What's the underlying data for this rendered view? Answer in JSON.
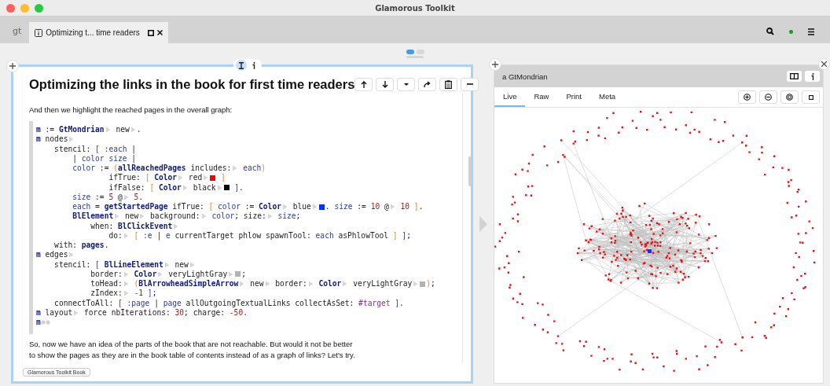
{
  "window": {
    "title": "Glamorous Toolkit"
  },
  "tabbar": {
    "logo": "gt",
    "tabs": [
      {
        "label": "Optimizing t... time readers",
        "selected": true
      }
    ]
  },
  "page": {
    "modes": [
      {
        "kind": "edit",
        "selected": true
      },
      {
        "kind": "info",
        "selected": false
      }
    ],
    "title": "Optimizing the links in the book for first time readers",
    "intro": "And then we highlight the reached pages in the overall graph:",
    "code": [
      [
        {
          "kind": "var",
          "text": "m"
        },
        {
          "kind": "plain",
          "text": " := "
        },
        {
          "kind": "cls",
          "text": "GtMondrian"
        },
        {
          "kind": "arrow"
        },
        {
          "kind": "plain",
          "text": " new"
        },
        {
          "kind": "arrow"
        },
        {
          "kind": "plain",
          "text": "."
        }
      ],
      [
        {
          "kind": "var",
          "text": "m"
        },
        {
          "kind": "plain",
          "text": " nodes"
        },
        {
          "kind": "arrow"
        }
      ],
      [
        {
          "kind": "plain",
          "text": "    stencil: "
        },
        {
          "kind": "ident",
          "text": "[ :each"
        },
        {
          "kind": "plain",
          "text": " |"
        }
      ],
      [
        {
          "kind": "plain",
          "text": "        | "
        },
        {
          "kind": "ident",
          "text": "color size"
        },
        {
          "kind": "plain",
          "text": " |"
        }
      ],
      [
        {
          "kind": "ident",
          "text": "        color"
        },
        {
          "kind": "plain",
          "text": " := "
        },
        {
          "kind": "brk",
          "text": "("
        },
        {
          "kind": "cls",
          "text": "allReachedPages"
        },
        {
          "kind": "plain",
          "text": " includes:"
        },
        {
          "kind": "arrow"
        },
        {
          "kind": "ident",
          "text": " each"
        },
        {
          "kind": "brk",
          "text": ")"
        }
      ],
      [
        {
          "kind": "plain",
          "text": "                ifTrue: "
        },
        {
          "kind": "brk",
          "text": "[ "
        },
        {
          "kind": "cls",
          "text": "Color"
        },
        {
          "kind": "arrow"
        },
        {
          "kind": "plain",
          "text": " red"
        },
        {
          "kind": "arrow"
        },
        {
          "kind": "swatch",
          "color": "#ff0000"
        },
        {
          "kind": "brk",
          "text": " ]"
        }
      ],
      [
        {
          "kind": "plain",
          "text": "                ifFalse: "
        },
        {
          "kind": "brk",
          "text": "[ "
        },
        {
          "kind": "cls",
          "text": "Color"
        },
        {
          "kind": "arrow"
        },
        {
          "kind": "plain",
          "text": " black"
        },
        {
          "kind": "arrow"
        },
        {
          "kind": "swatch",
          "color": "#000000"
        },
        {
          "kind": "ident",
          "text": " ]"
        },
        {
          "kind": "plain",
          "text": "."
        }
      ],
      [
        {
          "kind": "ident",
          "text": "        size"
        },
        {
          "kind": "plain",
          "text": " := "
        },
        {
          "kind": "num",
          "text": "5"
        },
        {
          "kind": "plain",
          "text": " @"
        },
        {
          "kind": "arrow"
        },
        {
          "kind": "num",
          "text": " 5"
        },
        {
          "kind": "plain",
          "text": "."
        }
      ],
      [
        {
          "kind": "ident",
          "text": "        each"
        },
        {
          "kind": "plain",
          "text": " = "
        },
        {
          "kind": "cls",
          "text": "getStartedPage"
        },
        {
          "kind": "plain",
          "text": " ifTrue: "
        },
        {
          "kind": "brk",
          "text": "[ "
        },
        {
          "kind": "ident",
          "text": "color"
        },
        {
          "kind": "plain",
          "text": " := "
        },
        {
          "kind": "cls",
          "text": "Color"
        },
        {
          "kind": "arrow"
        },
        {
          "kind": "plain",
          "text": " blue"
        },
        {
          "kind": "arrow"
        },
        {
          "kind": "swatch",
          "color": "#0033ff"
        },
        {
          "kind": "plain",
          "text": ". "
        },
        {
          "kind": "ident",
          "text": "size"
        },
        {
          "kind": "plain",
          "text": " := "
        },
        {
          "kind": "num",
          "text": "10"
        },
        {
          "kind": "plain",
          "text": " @"
        },
        {
          "kind": "arrow"
        },
        {
          "kind": "num",
          "text": " 10"
        },
        {
          "kind": "brk",
          "text": " ]"
        },
        {
          "kind": "plain",
          "text": "."
        }
      ],
      [
        {
          "kind": "cls",
          "text": "        BlElement"
        },
        {
          "kind": "arrow"
        },
        {
          "kind": "plain",
          "text": " new"
        },
        {
          "kind": "arrow"
        },
        {
          "kind": "plain",
          "text": " background:"
        },
        {
          "kind": "arrow"
        },
        {
          "kind": "ident",
          "text": " color"
        },
        {
          "kind": "plain",
          "text": "; size:"
        },
        {
          "kind": "arrow"
        },
        {
          "kind": "ident",
          "text": " size"
        },
        {
          "kind": "plain",
          "text": ";"
        }
      ],
      [
        {
          "kind": "plain",
          "text": "            when: "
        },
        {
          "kind": "cls",
          "text": "BlClickEvent"
        },
        {
          "kind": "arrow"
        }
      ],
      [
        {
          "kind": "plain",
          "text": "                do:"
        },
        {
          "kind": "arrow"
        },
        {
          "kind": "brk",
          "text": " [ "
        },
        {
          "kind": "ident",
          "text": ":e"
        },
        {
          "kind": "plain",
          "text": " | "
        },
        {
          "kind": "ident",
          "text": "e"
        },
        {
          "kind": "plain",
          "text": " currentTarget phlow spawnTool: "
        },
        {
          "kind": "ident",
          "text": "each"
        },
        {
          "kind": "plain",
          "text": " asPhlowTool "
        },
        {
          "kind": "brk",
          "text": "]"
        },
        {
          "kind": "ident",
          "text": " ]"
        },
        {
          "kind": "plain",
          "text": ";"
        }
      ],
      [
        {
          "kind": "plain",
          "text": "    with: "
        },
        {
          "kind": "cls",
          "text": "pages"
        },
        {
          "kind": "plain",
          "text": "."
        }
      ],
      [
        {
          "kind": "var",
          "text": "m"
        },
        {
          "kind": "plain",
          "text": " edges"
        },
        {
          "kind": "arrow"
        }
      ],
      [
        {
          "kind": "plain",
          "text": "    stencil: "
        },
        {
          "kind": "ident",
          "text": "[ "
        },
        {
          "kind": "cls",
          "text": "BlLineElement"
        },
        {
          "kind": "arrow"
        },
        {
          "kind": "plain",
          "text": " new"
        },
        {
          "kind": "arrow"
        }
      ],
      [
        {
          "kind": "plain",
          "text": "            border:"
        },
        {
          "kind": "arrow"
        },
        {
          "kind": "cls",
          "text": " Color"
        },
        {
          "kind": "arrow"
        },
        {
          "kind": "plain",
          "text": " veryLightGray"
        },
        {
          "kind": "arrow"
        },
        {
          "kind": "swatch",
          "color": "#b3b3b3"
        },
        {
          "kind": "plain",
          "text": ";"
        }
      ],
      [
        {
          "kind": "plain",
          "text": "            toHead:"
        },
        {
          "kind": "arrow"
        },
        {
          "kind": "brk",
          "text": " ("
        },
        {
          "kind": "cls",
          "text": "BlArrowheadSimpleArrow"
        },
        {
          "kind": "arrow"
        },
        {
          "kind": "plain",
          "text": " new"
        },
        {
          "kind": "arrow"
        },
        {
          "kind": "plain",
          "text": " border:"
        },
        {
          "kind": "arrow"
        },
        {
          "kind": "cls",
          "text": " Color"
        },
        {
          "kind": "arrow"
        },
        {
          "kind": "plain",
          "text": " veryLightGray"
        },
        {
          "kind": "arrow"
        },
        {
          "kind": "swatch",
          "color": "#b3b3b3"
        },
        {
          "kind": "brk",
          "text": ")"
        },
        {
          "kind": "plain",
          "text": ";"
        }
      ],
      [
        {
          "kind": "plain",
          "text": "            zIndex:"
        },
        {
          "kind": "arrow"
        },
        {
          "kind": "num",
          "text": " -1"
        },
        {
          "kind": "ident",
          "text": " ]"
        },
        {
          "kind": "plain",
          "text": ";"
        }
      ],
      [
        {
          "kind": "plain",
          "text": "    connectToAll: "
        },
        {
          "kind": "ident",
          "text": "[ :page"
        },
        {
          "kind": "plain",
          "text": " | "
        },
        {
          "kind": "ident",
          "text": "page"
        },
        {
          "kind": "plain",
          "text": " allOutgoingTextualLinks collectAsSet: "
        },
        {
          "kind": "sym",
          "text": "#target"
        },
        {
          "kind": "ident",
          "text": " ]"
        },
        {
          "kind": "plain",
          "text": "."
        }
      ],
      [
        {
          "kind": "var",
          "text": "m"
        },
        {
          "kind": "plain",
          "text": " layout"
        },
        {
          "kind": "arrow"
        },
        {
          "kind": "plain",
          "text": " force nbIterations: "
        },
        {
          "kind": "num",
          "text": "30"
        },
        {
          "kind": "plain",
          "text": "; charge: "
        },
        {
          "kind": "num",
          "text": "-50"
        },
        {
          "kind": "plain",
          "text": "."
        }
      ],
      [
        {
          "kind": "var",
          "text": "m"
        },
        {
          "kind": "dots"
        }
      ]
    ],
    "outro": "So, now we have an idea of the parts of the book that are not reachable. But would it not be better to show the pages as they are in the book table of contents instead of as a graph of links? Let's try.",
    "footer": "Glamorous Toolkit Book"
  },
  "inspector": {
    "title": "a GtMondrian",
    "tabs": [
      {
        "label": "Live",
        "selected": true
      },
      {
        "label": "Raw",
        "selected": false
      },
      {
        "label": "Print",
        "selected": false
      },
      {
        "label": "Meta",
        "selected": false
      }
    ]
  }
}
